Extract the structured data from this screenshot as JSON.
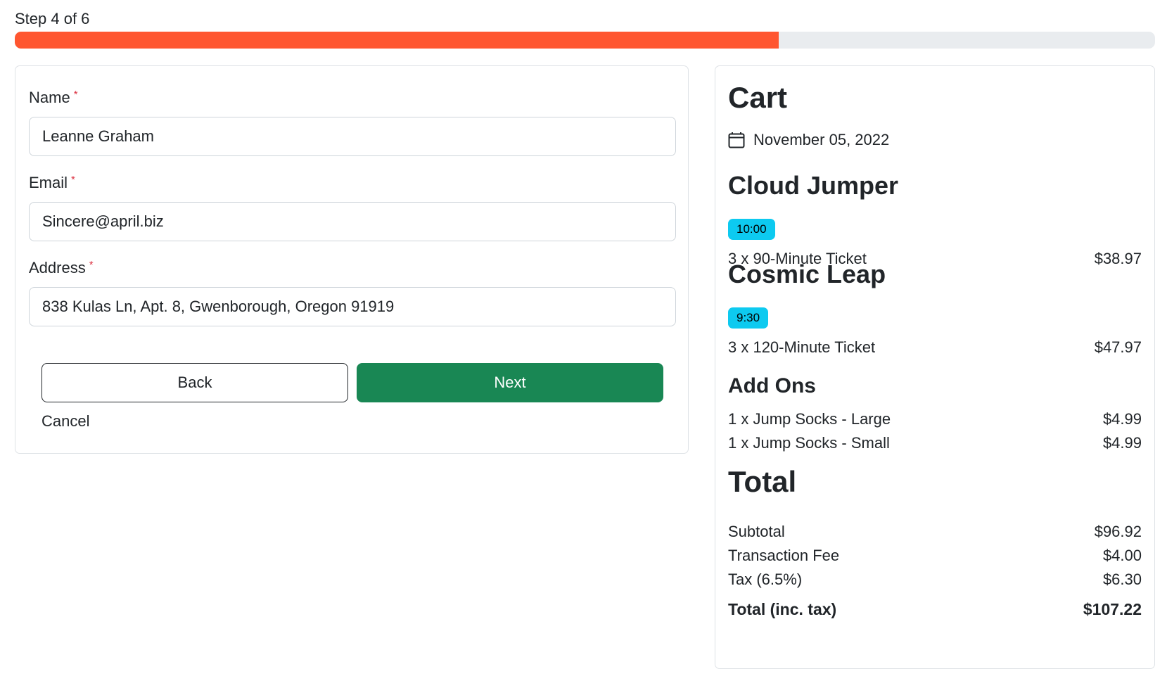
{
  "progress": {
    "label": "Step 4 of 6",
    "fraction": 0.67,
    "color": "#ff5630",
    "track_color": "#e9ecef"
  },
  "form": {
    "name": {
      "label": "Name",
      "required_mark": "*",
      "value": "Leanne Graham"
    },
    "email": {
      "label": "Email",
      "required_mark": "*",
      "value": "Sincere@april.biz"
    },
    "address": {
      "label": "Address",
      "required_mark": "*",
      "value": "838 Kulas Ln, Apt. 8, Gwenborough, Oregon 91919"
    },
    "back_label": "Back",
    "next_label": "Next",
    "cancel_label": "Cancel",
    "next_color": "#198754"
  },
  "cart": {
    "title": "Cart",
    "date_icon": "calendar-icon",
    "date": "November 05, 2022",
    "products": [
      {
        "name": "Cloud Jumper",
        "time": "10:00",
        "line": "3 x 90-Minute Ticket",
        "price": "$38.97"
      },
      {
        "name": "Cosmic Leap",
        "time": "9:30",
        "line": "3 x 120-Minute Ticket",
        "price": "$47.97"
      }
    ],
    "addons_title": "Add Ons",
    "addons": [
      {
        "line": "1 x Jump Socks - Large",
        "price": "$4.99"
      },
      {
        "line": "1 x Jump Socks - Small",
        "price": "$4.99"
      }
    ],
    "total_title": "Total",
    "subtotal": {
      "label": "Subtotal",
      "value": "$96.92"
    },
    "fee": {
      "label": "Transaction Fee",
      "value": "$4.00"
    },
    "tax": {
      "label": "Tax (6.5%)",
      "value": "$6.30"
    },
    "grand_total": {
      "label": "Total (inc. tax)",
      "value": "$107.22"
    },
    "badge_color": "#0dcaf0"
  }
}
